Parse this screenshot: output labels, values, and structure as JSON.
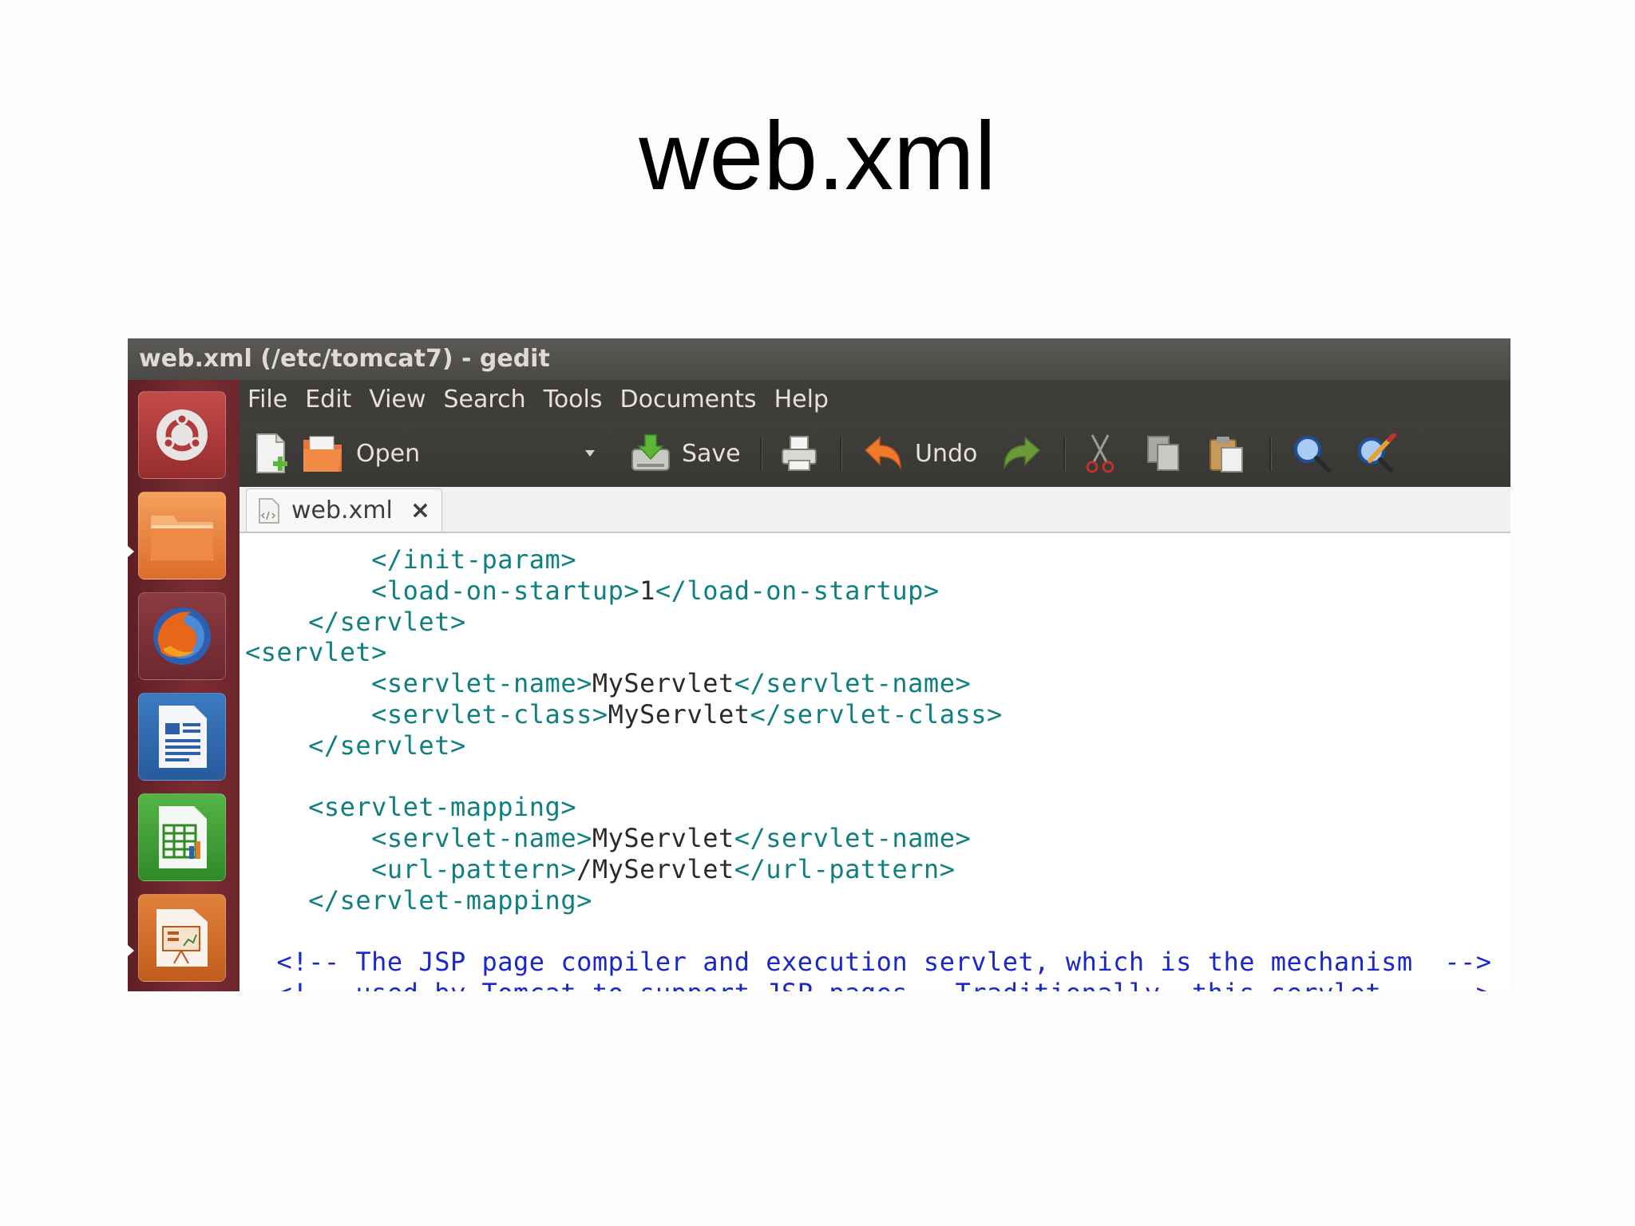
{
  "slide": {
    "title": "web.xml"
  },
  "window": {
    "title": "web.xml (/etc/tomcat7) - gedit"
  },
  "launcher": {
    "items": [
      {
        "name": "ubuntu-dash"
      },
      {
        "name": "files"
      },
      {
        "name": "firefox"
      },
      {
        "name": "libreoffice-writer"
      },
      {
        "name": "libreoffice-calc"
      },
      {
        "name": "libreoffice-impress"
      }
    ]
  },
  "menu": [
    "File",
    "Edit",
    "View",
    "Search",
    "Tools",
    "Documents",
    "Help"
  ],
  "toolbar": {
    "open_label": "Open",
    "save_label": "Save",
    "undo_label": "Undo",
    "icons": [
      "new-document-icon",
      "open-folder-icon",
      "dropdown-arrow-icon",
      "save-icon",
      "print-icon",
      "undo-icon",
      "redo-icon",
      "cut-icon",
      "copy-icon",
      "paste-icon",
      "find-icon",
      "find-replace-icon"
    ]
  },
  "tab": {
    "label": "web.xml",
    "close": "×"
  },
  "code": {
    "lines": [
      {
        "segments": [
          {
            "cls": "c-tag",
            "text": "        </init-param>"
          }
        ]
      },
      {
        "segments": [
          {
            "cls": "c-tag",
            "text": "        <load-on-startup>"
          },
          {
            "cls": "c-text",
            "text": "1"
          },
          {
            "cls": "c-tag",
            "text": "</load-on-startup>"
          }
        ]
      },
      {
        "segments": [
          {
            "cls": "c-tag",
            "text": "    </servlet>"
          }
        ]
      },
      {
        "segments": [
          {
            "cls": "c-tag",
            "text": "<servlet>"
          }
        ]
      },
      {
        "segments": [
          {
            "cls": "c-tag",
            "text": "        <servlet-name>"
          },
          {
            "cls": "c-text",
            "text": "MyServlet"
          },
          {
            "cls": "c-tag",
            "text": "</servlet-name>"
          }
        ]
      },
      {
        "segments": [
          {
            "cls": "c-tag",
            "text": "        <servlet-class>"
          },
          {
            "cls": "c-text",
            "text": "MyServlet"
          },
          {
            "cls": "c-tag",
            "text": "</servlet-class>"
          }
        ]
      },
      {
        "segments": [
          {
            "cls": "c-tag",
            "text": "    </servlet>"
          }
        ]
      },
      {
        "segments": []
      },
      {
        "segments": [
          {
            "cls": "c-tag",
            "text": "    <servlet-mapping>"
          }
        ]
      },
      {
        "segments": [
          {
            "cls": "c-tag",
            "text": "        <servlet-name>"
          },
          {
            "cls": "c-text",
            "text": "MyServlet"
          },
          {
            "cls": "c-tag",
            "text": "</servlet-name>"
          }
        ]
      },
      {
        "segments": [
          {
            "cls": "c-tag",
            "text": "        <url-pattern>"
          },
          {
            "cls": "c-text",
            "text": "/MyServlet"
          },
          {
            "cls": "c-tag",
            "text": "</url-pattern>"
          }
        ]
      },
      {
        "segments": [
          {
            "cls": "c-tag",
            "text": "    </servlet-mapping>"
          }
        ]
      },
      {
        "segments": []
      },
      {
        "segments": [
          {
            "cls": "c-comment",
            "text": "  <!-- The JSP page compiler and execution servlet, which is the mechanism  -->"
          }
        ]
      },
      {
        "segments": [
          {
            "cls": "c-comment",
            "text": "  <!-- used by Tomcat to support JSP pages.  Traditionally, this servlet    -->"
          }
        ]
      }
    ]
  },
  "colors": {
    "tag": "#0f7f7f",
    "text": "#2a2a2a",
    "comment": "#1a28c8",
    "launcher": "#7b2d33",
    "toolbar": "#3e3d39"
  }
}
